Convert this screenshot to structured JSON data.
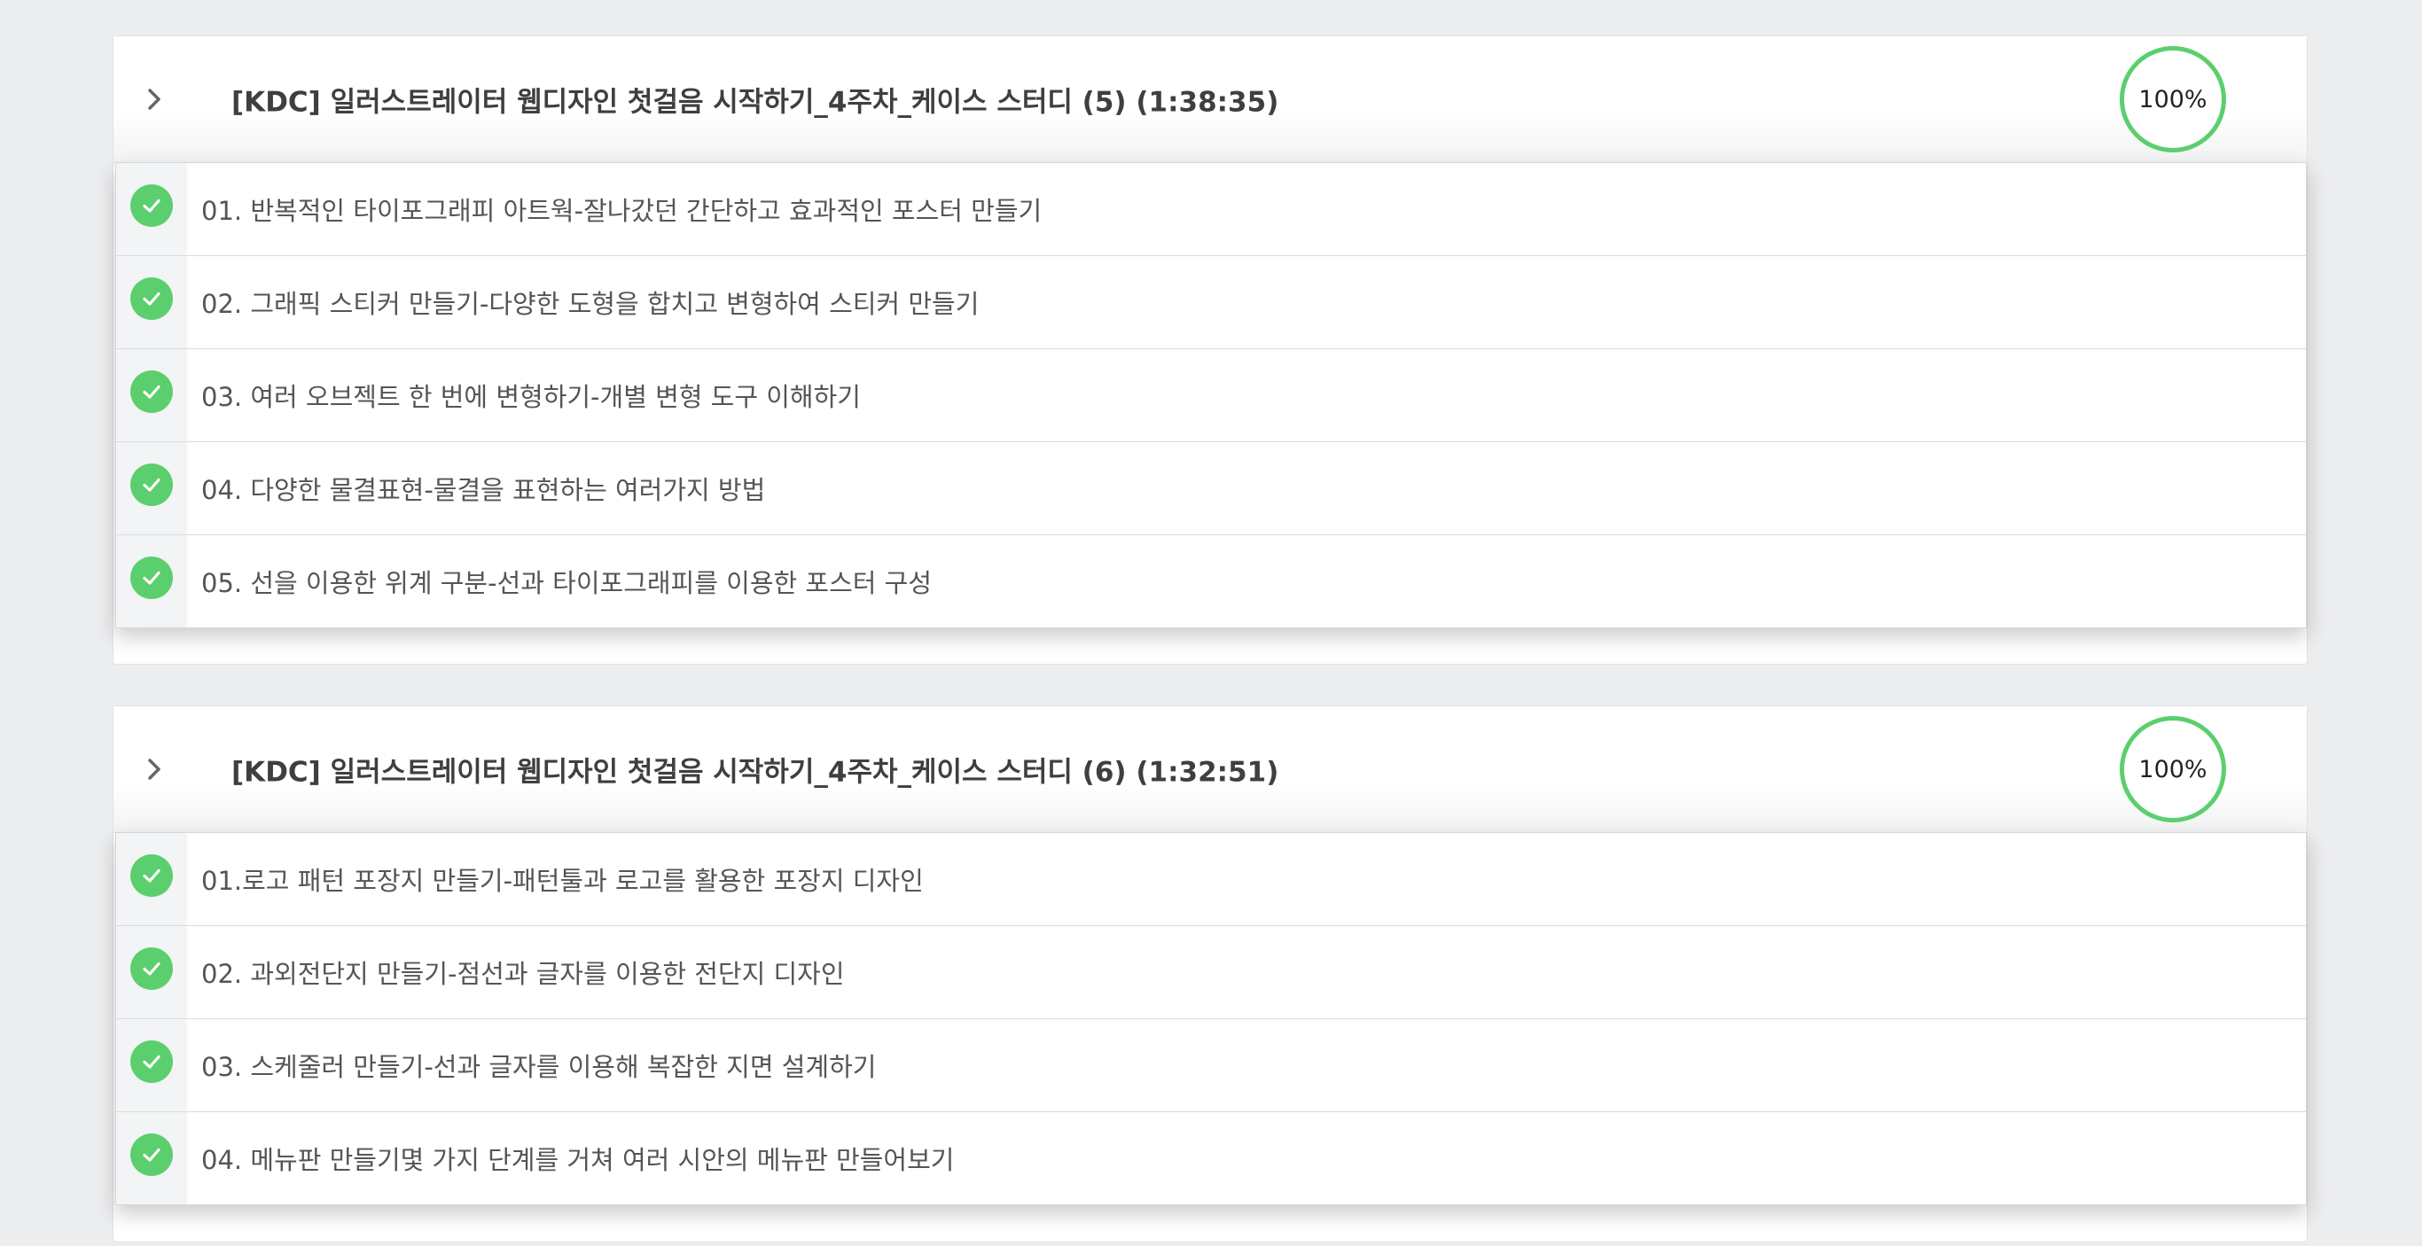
{
  "colors": {
    "accent": "#5bcf6e",
    "background": "#ecedef"
  },
  "sections": [
    {
      "title": "[KDC] 일러스트레이터 웹디자인 첫걸음 시작하기_4주차_케이스 스터디 (5) (1:38:35)",
      "progress": "100%",
      "progress_value": 1.0,
      "lessons": [
        {
          "label": "01. 반복적인 타이포그래피 아트웍-잘나갔던 간단하고 효과적인 포스터 만들기",
          "completed": true
        },
        {
          "label": "02. 그래픽 스티커 만들기-다양한 도형을 합치고 변형하여 스티커 만들기",
          "completed": true
        },
        {
          "label": "03. 여러 오브젝트 한 번에 변형하기-개별 변형 도구 이해하기",
          "completed": true
        },
        {
          "label": "04. 다양한 물결표현-물결을 표현하는 여러가지 방법",
          "completed": true
        },
        {
          "label": "05. 선을 이용한 위계 구분-선과 타이포그래피를 이용한 포스터 구성",
          "completed": true
        }
      ]
    },
    {
      "title": "[KDC] 일러스트레이터 웹디자인 첫걸음 시작하기_4주차_케이스 스터디 (6) (1:32:51)",
      "progress": "100%",
      "progress_value": 1.0,
      "lessons": [
        {
          "label": "01.로고 패턴 포장지 만들기-패턴툴과 로고를 활용한 포장지 디자인",
          "completed": true
        },
        {
          "label": "02. 과외전단지 만들기-점선과 글자를 이용한 전단지 디자인",
          "completed": true
        },
        {
          "label": "03. 스케줄러 만들기-선과 글자를 이용해 복잡한 지면 설계하기",
          "completed": true
        },
        {
          "label": "04. 메뉴판 만들기몇 가지 단계를 거쳐 여러 시안의 메뉴판 만들어보기",
          "completed": true
        }
      ]
    }
  ]
}
